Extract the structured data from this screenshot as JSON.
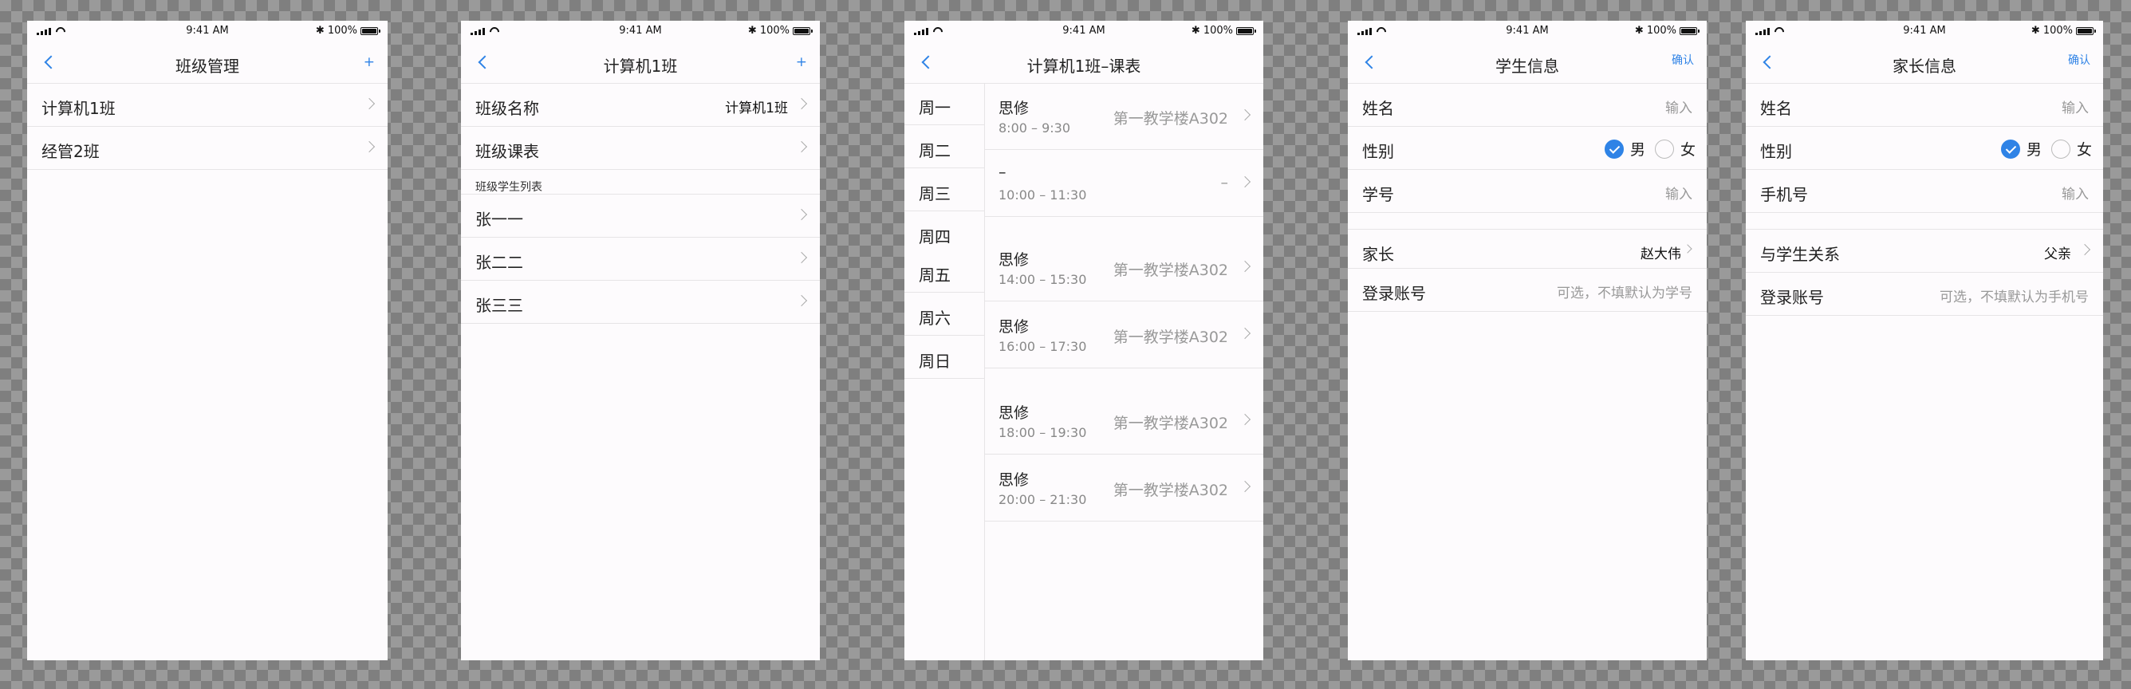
{
  "status": {
    "time": "9:41 AM",
    "battery": "100%"
  },
  "screen1": {
    "title": "班级管理",
    "action": "+",
    "rows": [
      {
        "label": "计算机1班"
      },
      {
        "label": "经管2班"
      }
    ]
  },
  "screen2": {
    "title": "计算机1班",
    "action": "+",
    "class_name_label": "班级名称",
    "class_name_value": "计算机1班",
    "schedule_label": "班级课表",
    "section": "班级学生列表",
    "students": [
      {
        "label": "张一一"
      },
      {
        "label": "张二二"
      },
      {
        "label": "张三三"
      }
    ]
  },
  "screen3": {
    "title": "计算机1班–课表",
    "days": [
      "周一",
      "周二",
      "周三",
      "周四",
      "周五",
      "周六",
      "周日"
    ],
    "lessons": [
      {
        "course": "思修",
        "time": "8:00 – 9:30",
        "room": "第一教学楼A302"
      },
      {
        "course": "–",
        "time": "10:00 – 11:30",
        "room": "–"
      },
      {
        "course": "思修",
        "time": "14:00 – 15:30",
        "room": "第一教学楼A302"
      },
      {
        "course": "思修",
        "time": "16:00 – 17:30",
        "room": "第一教学楼A302"
      },
      {
        "course": "思修",
        "time": "18:00 – 19:30",
        "room": "第一教学楼A302"
      },
      {
        "course": "思修",
        "time": "20:00 – 21:30",
        "room": "第一教学楼A302"
      }
    ]
  },
  "screen4": {
    "title": "学生信息",
    "action": "确认",
    "name_label": "姓名",
    "name_placeholder": "输入",
    "gender_label": "性别",
    "male": "男",
    "female": "女",
    "gender_selected": "男",
    "id_label": "学号",
    "id_placeholder": "输入",
    "parent_label": "家长",
    "parent_value": "赵大伟",
    "account_label": "登录账号",
    "account_placeholder": "可选，不填默认为学号"
  },
  "screen5": {
    "title": "家长信息",
    "action": "确认",
    "name_label": "姓名",
    "name_placeholder": "输入",
    "gender_label": "性别",
    "male": "男",
    "female": "女",
    "gender_selected": "男",
    "phone_label": "手机号",
    "phone_placeholder": "输入",
    "relation_label": "与学生关系",
    "relation_value": "父亲",
    "account_label": "登录账号",
    "account_placeholder": "可选，不填默认为手机号"
  },
  "colors": {
    "accent": "#2f83e6",
    "background": "#fdfbfd",
    "divider": "#e6e4e6"
  }
}
